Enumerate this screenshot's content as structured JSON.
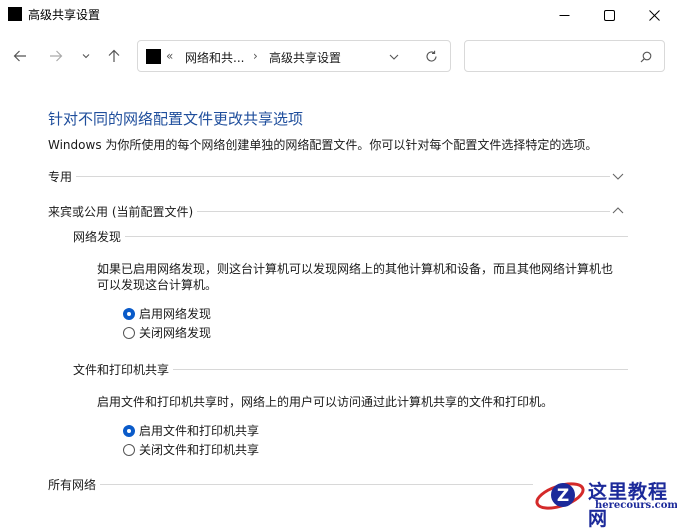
{
  "window": {
    "title": "高级共享设置"
  },
  "address": {
    "overflow": "«",
    "crumb1": "网络和共...",
    "sep": "›",
    "crumb2": "高级共享设置"
  },
  "search": {
    "placeholder": ""
  },
  "page": {
    "heading": "针对不同的网络配置文件更改共享选项",
    "description": "Windows 为你所使用的每个网络创建单独的网络配置文件。你可以针对每个配置文件选择特定的选项。"
  },
  "sections": {
    "private": {
      "label": "专用",
      "expanded": false
    },
    "guest_public": {
      "label": "来宾或公用 (当前配置文件)",
      "expanded": true
    },
    "all_networks": {
      "label": "所有网络",
      "expanded": false
    }
  },
  "network_discovery": {
    "label": "网络发现",
    "text_line1": "如果已启用网络发现，则这台计算机可以发现网络上的其他计算机和设备，而且其他网络计算机也",
    "text_line2": "可以发现这台计算机。",
    "option_on": "启用网络发现",
    "option_off": "关闭网络发现",
    "selected": "on"
  },
  "file_printer_sharing": {
    "label": "文件和打印机共享",
    "text": "启用文件和打印机共享时，网络上的用户可以访问通过此计算机共享的文件和打印机。",
    "option_on": "启用文件和打印机共享",
    "option_off": "关闭文件和打印机共享",
    "selected": "on"
  },
  "watermark": {
    "cn": "这里教程网",
    "en": "herecours.com"
  },
  "colors": {
    "accent": "#0a5bc9",
    "heading": "#1f4e9c"
  }
}
